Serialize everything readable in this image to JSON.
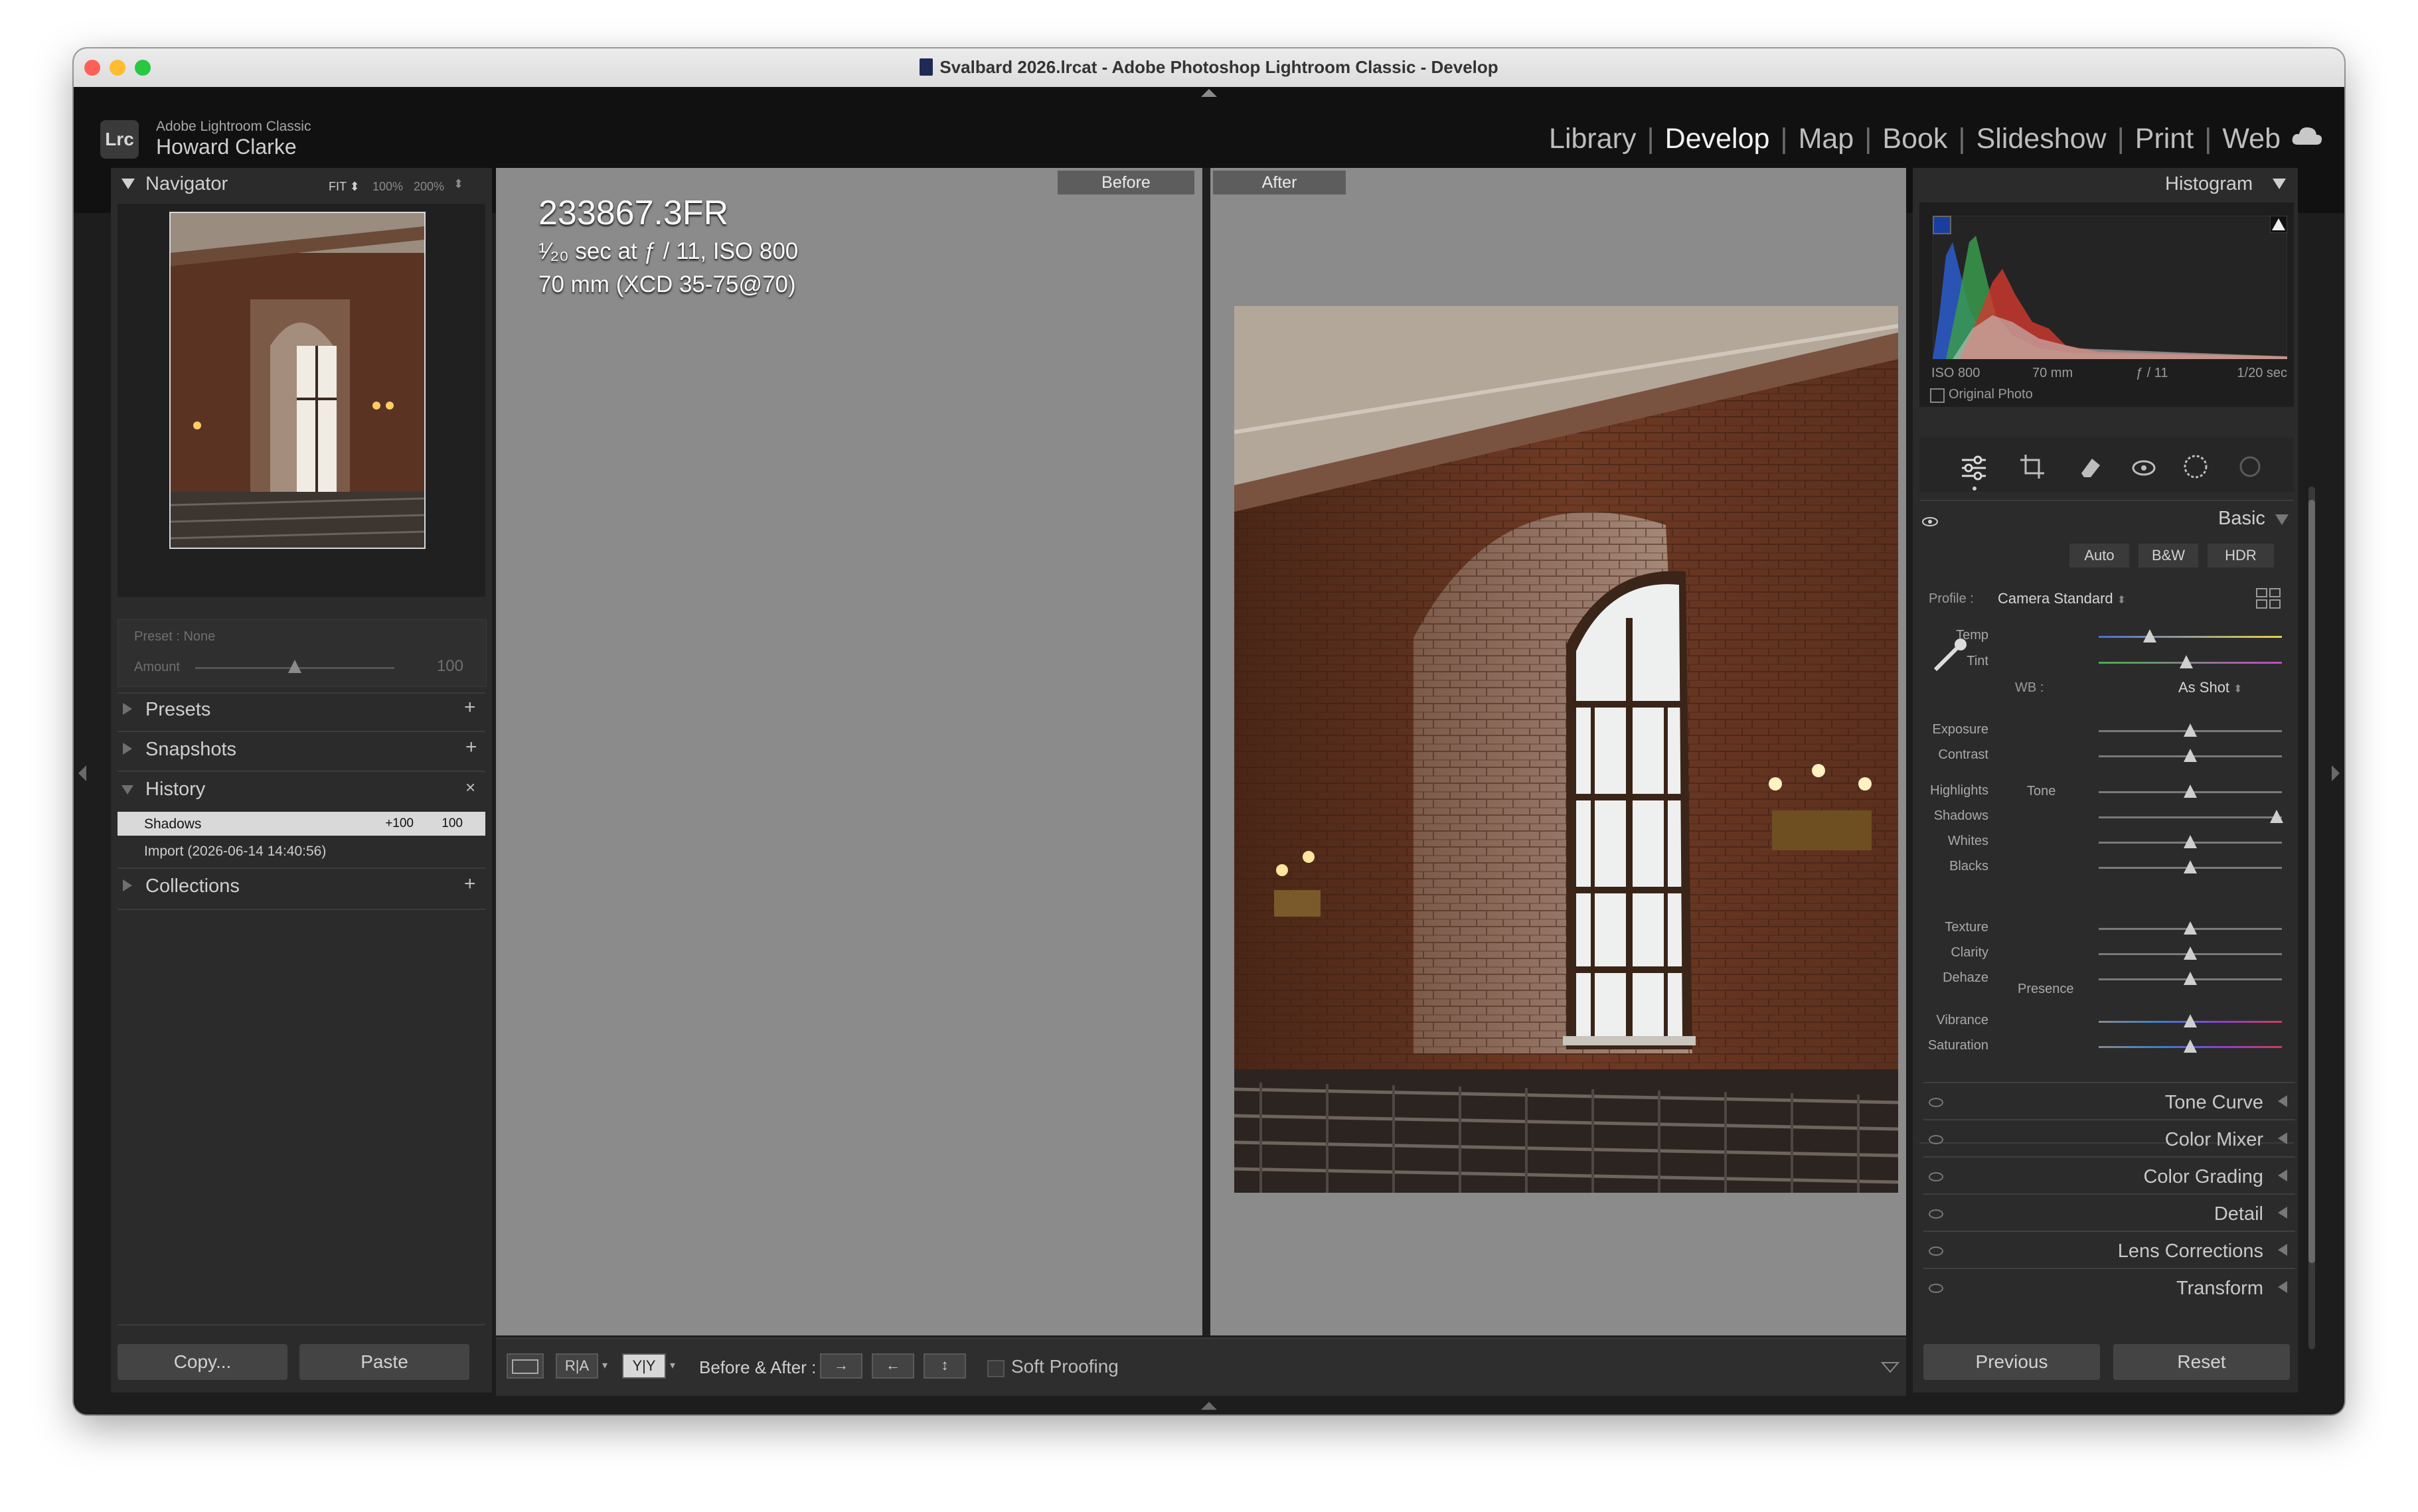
{
  "window": {
    "title": "Svalbard 2026.lrcat - Adobe Photoshop Lightroom Classic - Develop"
  },
  "brand": {
    "product": "Adobe Lightroom Classic",
    "user": "Howard Clarke",
    "logo": "Lrc"
  },
  "modules": {
    "items": [
      "Library",
      "Develop",
      "Map",
      "Book",
      "Slideshow",
      "Print",
      "Web"
    ],
    "active": "Develop"
  },
  "navigator": {
    "title": "Navigator",
    "zoom_fit": "FIT",
    "zoom_100": "100%",
    "zoom_200": "200%"
  },
  "preset_amount": {
    "preset_label": "Preset : None",
    "amount_label": "Amount",
    "amount_value": "100",
    "amount_fraction": 0.5
  },
  "left_sections": {
    "presets": "Presets",
    "snapshots": "Snapshots",
    "history": "History",
    "collections": "Collections",
    "history_close": "×"
  },
  "history_items": [
    {
      "name": "Shadows",
      "change": "+100",
      "value": "100",
      "selected": true
    },
    {
      "name": "Import (2026-06-14 14:40:56)",
      "change": "",
      "value": "",
      "selected": false
    }
  ],
  "left_buttons": {
    "copy": "Copy...",
    "paste": "Paste"
  },
  "image_info": {
    "filename": "233867.3FR",
    "exposure_line": "¹⁄₂₀ sec at ƒ / 11, ISO 800",
    "lens_line": "70 mm (XCD 35-75@70)"
  },
  "compare": {
    "before_label": "Before",
    "after_label": "After"
  },
  "toolbar": {
    "before_after_label": "Before & After :",
    "soft_proofing": "Soft Proofing",
    "view_ra": "R|A",
    "view_yy": "Y|Y"
  },
  "histogram": {
    "title": "Histogram",
    "iso": "ISO 800",
    "focal": "70 mm",
    "aperture": "ƒ / 11",
    "shutter": "1/20 sec",
    "original_photo": "Original Photo"
  },
  "basic": {
    "title": "Basic",
    "auto": "Auto",
    "bw": "B&W",
    "hdr": "HDR",
    "profile_label": "Profile :",
    "profile_value": "Camera Standard",
    "wb_label": "WB :",
    "wb_value": "As Shot",
    "tone_label": "Tone",
    "presence_label": "Presence"
  },
  "sliders": [
    {
      "key": "temp",
      "label": "Temp",
      "value": "4,600",
      "pos": 0.28
    },
    {
      "key": "tint",
      "label": "Tint",
      "value": "– 9",
      "pos": 0.48
    },
    {
      "key": "exposure",
      "label": "Exposure",
      "value": "0.00",
      "pos": 0.5
    },
    {
      "key": "contrast",
      "label": "Contrast",
      "value": "0",
      "pos": 0.5
    },
    {
      "key": "highlights",
      "label": "Highlights",
      "value": "0",
      "pos": 0.5
    },
    {
      "key": "shadows",
      "label": "Shadows",
      "value": "+ 100",
      "pos": 0.97
    },
    {
      "key": "whites",
      "label": "Whites",
      "value": "0",
      "pos": 0.5
    },
    {
      "key": "blacks",
      "label": "Blacks",
      "value": "0",
      "pos": 0.5
    },
    {
      "key": "texture",
      "label": "Texture",
      "value": "0",
      "pos": 0.5
    },
    {
      "key": "clarity",
      "label": "Clarity",
      "value": "0",
      "pos": 0.5
    },
    {
      "key": "dehaze",
      "label": "Dehaze",
      "value": "0",
      "pos": 0.5
    },
    {
      "key": "vibrance",
      "label": "Vibrance",
      "value": "0",
      "pos": 0.5
    },
    {
      "key": "saturation",
      "label": "Saturation",
      "value": "0",
      "pos": 0.5
    }
  ],
  "collapsed_sections": [
    "Tone Curve",
    "Color Mixer",
    "Color Grading",
    "Detail",
    "Lens Corrections",
    "Transform"
  ],
  "right_buttons": {
    "previous": "Previous",
    "reset": "Reset"
  },
  "colors": {
    "panel": "#2b2b2b",
    "background": "#1d1d1d",
    "canvas": "#8b8b8b",
    "text": "#cfcfcf",
    "close": "#ff5f57",
    "minimize": "#febc2e",
    "zoom": "#28c840"
  }
}
